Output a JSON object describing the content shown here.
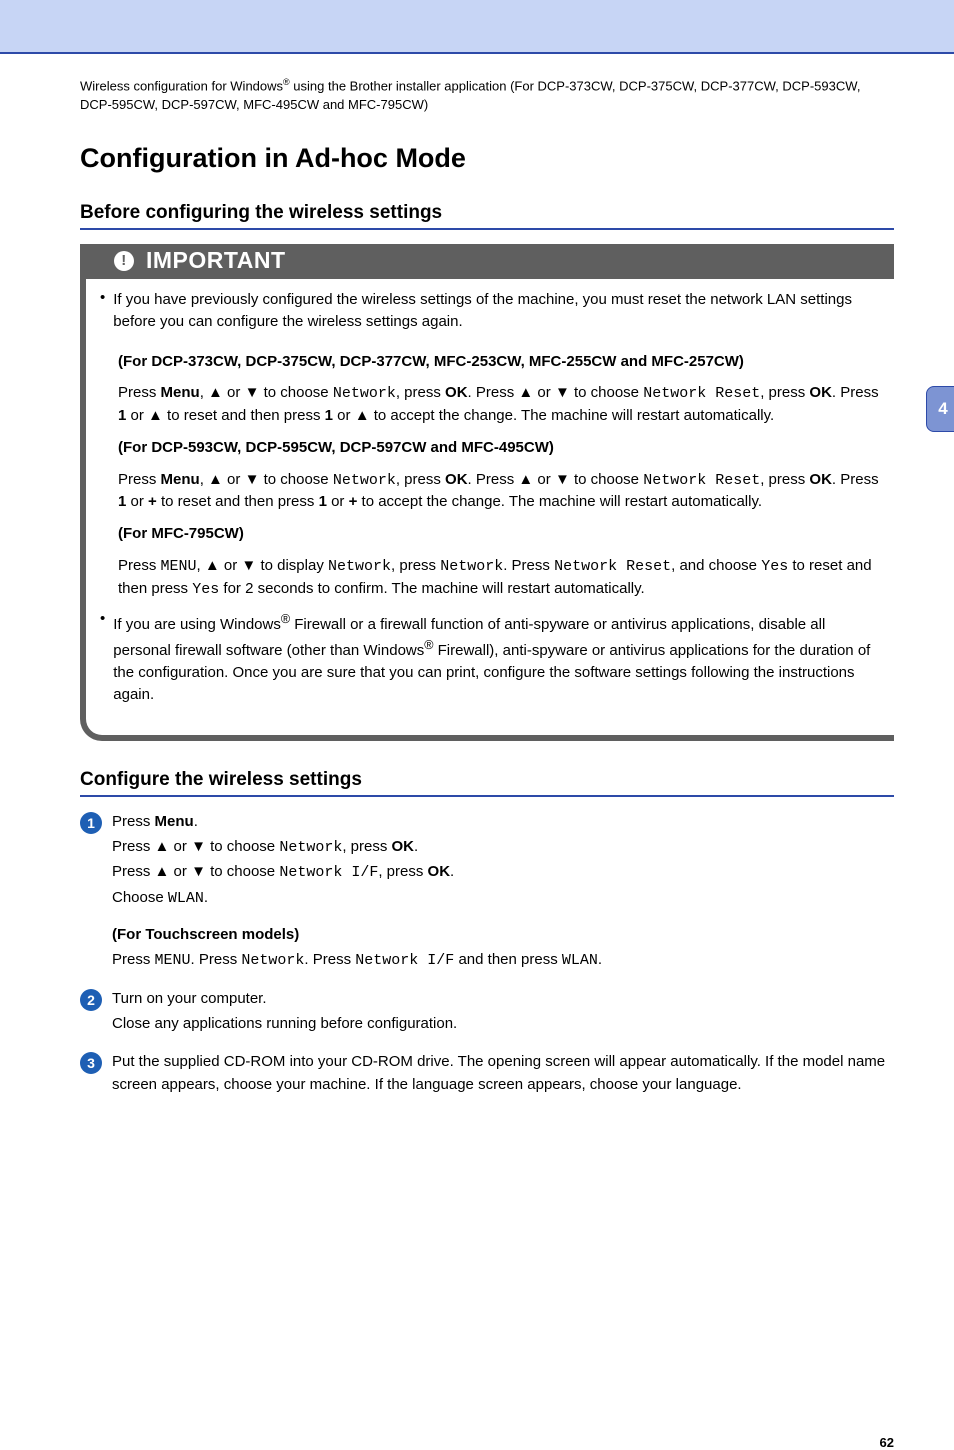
{
  "chapterTab": "4",
  "pageNumber": "62",
  "headerNote": {
    "prefix": "Wireless configuration for Windows",
    "suffix": " using the Brother installer application (For DCP-373CW, DCP-375CW, DCP-377CW, DCP-593CW, DCP-595CW, DCP-597CW, MFC-495CW and MFC-795CW)"
  },
  "title": "Configuration in Ad-hoc Mode",
  "section1": "Before configuring the wireless settings",
  "importantLabel": "IMPORTANT",
  "imp": {
    "b1": "If you have previously configured the wireless settings of the machine, you must reset the network LAN settings before you can configure the wireless settings again.",
    "h1": "(For DCP-373CW, DCP-375CW, DCP-377CW, MFC-253CW, MFC-255CW and MFC-257CW)",
    "p1a": "Press ",
    "p1b": "Menu",
    "p1c": ", ",
    "p1d": "▲",
    "p1e": " or ",
    "p1f": "▼",
    "p1g": " to choose ",
    "p1h": "Network",
    "p1i": ", press ",
    "p1j": "OK",
    "p1k": ". Press ",
    "p1l": "▲",
    "p1m": " or ",
    "p1n": "▼",
    "p1o": " to choose ",
    "p1p": "Network Reset",
    "p1q": ", press ",
    "p1r": "OK",
    "p1s": ". Press ",
    "p1t": "1",
    "p1u": " or ",
    "p1v": "▲",
    "p1w": " to reset and then press ",
    "p1x": "1",
    "p1y": " or ",
    "p1z": "▲",
    "p1aa": " to accept the change. The machine will restart automatically.",
    "h2": "(For DCP-593CW, DCP-595CW, DCP-597CW and MFC-495CW)",
    "p2a": "Press ",
    "p2b": "Menu",
    "p2c": ", ",
    "p2d": "▲",
    "p2e": " or ",
    "p2f": "▼",
    "p2g": " to choose ",
    "p2h": "Network",
    "p2i": ", press ",
    "p2j": "OK",
    "p2k": ". Press ",
    "p2l": "▲",
    "p2m": " or ",
    "p2n": "▼",
    "p2o": " to choose ",
    "p2p": "Network Reset",
    "p2q": ", press ",
    "p2r": "OK",
    "p2s": ". Press ",
    "p2t": "1",
    "p2u": " or ",
    "p2v": "+",
    "p2w": " to reset and then press ",
    "p2x": "1",
    "p2y": " or ",
    "p2z": "+",
    "p2aa": " to accept the change. The machine will restart automatically.",
    "h3": "(For MFC-795CW)",
    "p3a": "Press ",
    "p3b": "MENU",
    "p3c": ", ",
    "p3d": "▲",
    "p3e": " or ",
    "p3f": "▼",
    "p3g": " to display ",
    "p3h": "Network",
    "p3i": ", press ",
    "p3j": "Network",
    "p3k": ". Press ",
    "p3l": "Network Reset",
    "p3m": ", and choose ",
    "p3n": "Yes",
    "p3o": " to reset and then press ",
    "p3p": "Yes",
    "p3q": " for 2 seconds to confirm. The machine will restart automatically.",
    "b2a": "If you are using Windows",
    "b2b": " Firewall or a firewall function of anti-spyware or antivirus applications, disable all personal firewall software (other than Windows",
    "b2c": " Firewall), anti-spyware or antivirus applications for the duration of the configuration. Once you are sure that you can print, configure the software settings following the instructions again."
  },
  "section2": "Configure the wireless settings",
  "steps": {
    "s1": {
      "l1a": "Press ",
      "l1b": "Menu",
      "l1c": ".",
      "l2a": "Press ",
      "l2b": "▲",
      "l2c": " or ",
      "l2d": "▼",
      "l2e": " to choose ",
      "l2f": "Network",
      "l2g": ", press ",
      "l2h": "OK",
      "l2i": ".",
      "l3a": "Press ",
      "l3b": "▲",
      "l3c": " or ",
      "l3d": "▼",
      "l3e": " to choose ",
      "l3f": "Network I/F",
      "l3g": ", press ",
      "l3h": "OK",
      "l3i": ".",
      "l4a": "Choose ",
      "l4b": "WLAN",
      "l4c": ".",
      "sub": "(For Touchscreen models)",
      "ta": "Press ",
      "tb": "MENU",
      "tc": ". Press ",
      "td": "Network",
      "te": ". Press ",
      "tf": "Network I/F",
      "tg": " and then press ",
      "th": "WLAN",
      "ti": "."
    },
    "s2": {
      "l1": "Turn on your computer.",
      "l2": "Close any applications running before configuration."
    },
    "s3": "Put the supplied CD-ROM into your CD-ROM drive. The opening screen will appear automatically. If the model name screen appears, choose your machine. If the language screen appears, choose your language."
  }
}
